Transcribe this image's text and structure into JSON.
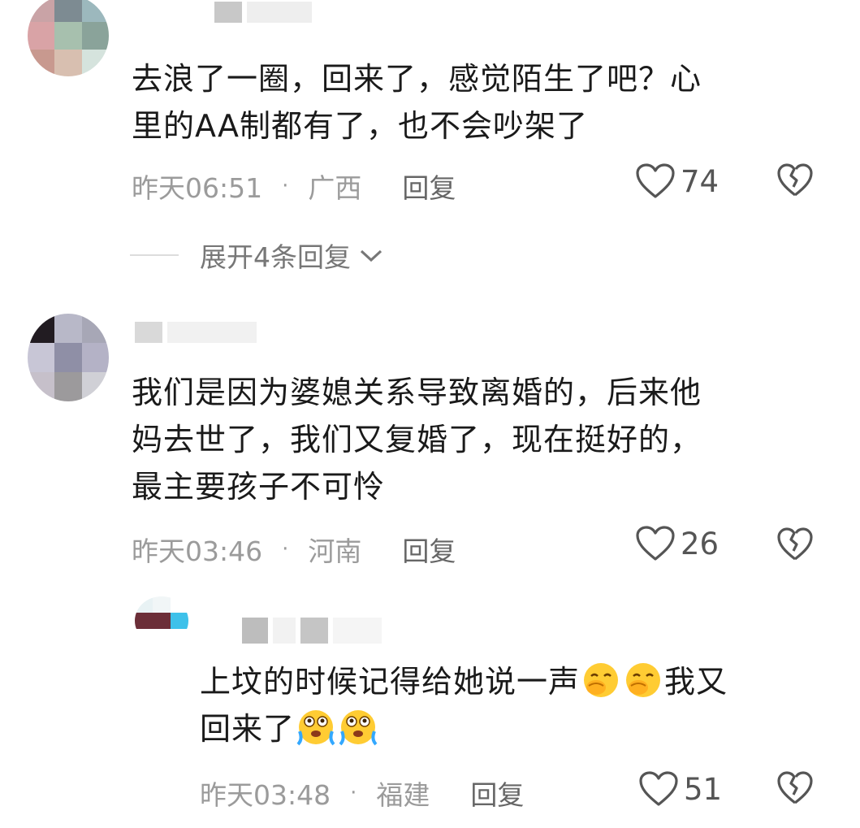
{
  "comments": [
    {
      "text": "去浪了一圈，回来了，感觉陌生了吧？心里的AA制都有了，也不会吵架了",
      "line1": "去浪了一圈，回来了，感觉陌生了吧？心",
      "line2": "里的AA制都有了，也不会吵架了",
      "time": "昨天06:51",
      "location": "广西",
      "reply_label": "回复",
      "likes": "74",
      "expand_label": "展开4条回复"
    },
    {
      "line1": "我们是因为婆媳关系导致离婚的，后来他",
      "line2": "妈去世了，我们又复婚了，现在挺好的，",
      "line3": "最主要孩子不可怜",
      "time": "昨天03:46",
      "location": "河南",
      "reply_label": "回复",
      "likes": "26"
    },
    {
      "line1": "上坟的时候记得给她说一声",
      "line1_end": "我又",
      "line2": "回来了",
      "time": "昨天03:48",
      "location": "福建",
      "reply_label": "回复",
      "likes": "51"
    }
  ],
  "separator": "·",
  "icons": {
    "like": "heart-outline-icon",
    "dislike": "broken-heart-icon",
    "expand": "chevron-down-icon",
    "emoji_cover": "covering-mouth-emoji",
    "emoji_cry": "crying-emoji"
  },
  "colors": {
    "text": "#1a1a1a",
    "meta": "#9b9b9b",
    "icon": "#555555"
  }
}
